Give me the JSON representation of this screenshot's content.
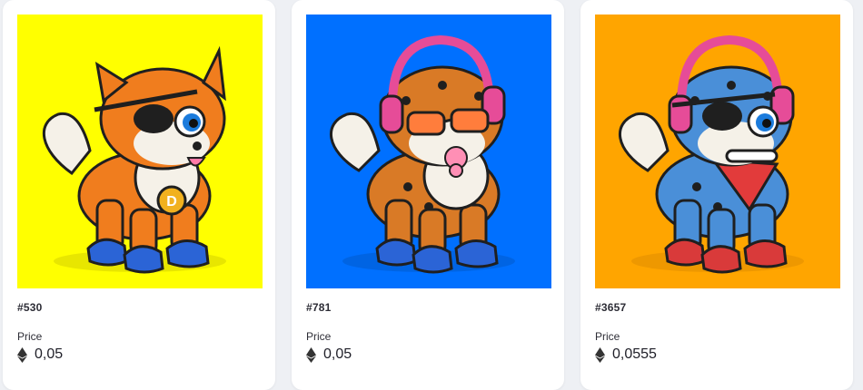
{
  "nft_cards": [
    {
      "token_id": "#530",
      "price_label": "Price",
      "price_value": "0,05",
      "background_color": "#FFFF00",
      "art_semantic": "cat-with-eyepatch-orange-tabby"
    },
    {
      "token_id": "#781",
      "price_label": "Price",
      "price_value": "0,05",
      "background_color": "#0070FF",
      "art_semantic": "leopard-cat-with-headphones-sunglasses-pacifier"
    },
    {
      "token_id": "#3657",
      "price_label": "Price",
      "price_value": "0,0555",
      "background_color": "#FFA500",
      "art_semantic": "blue-leopard-cat-with-eyepatch-headphones-bone"
    }
  ],
  "icons": {
    "currency": "ethereum-icon"
  }
}
